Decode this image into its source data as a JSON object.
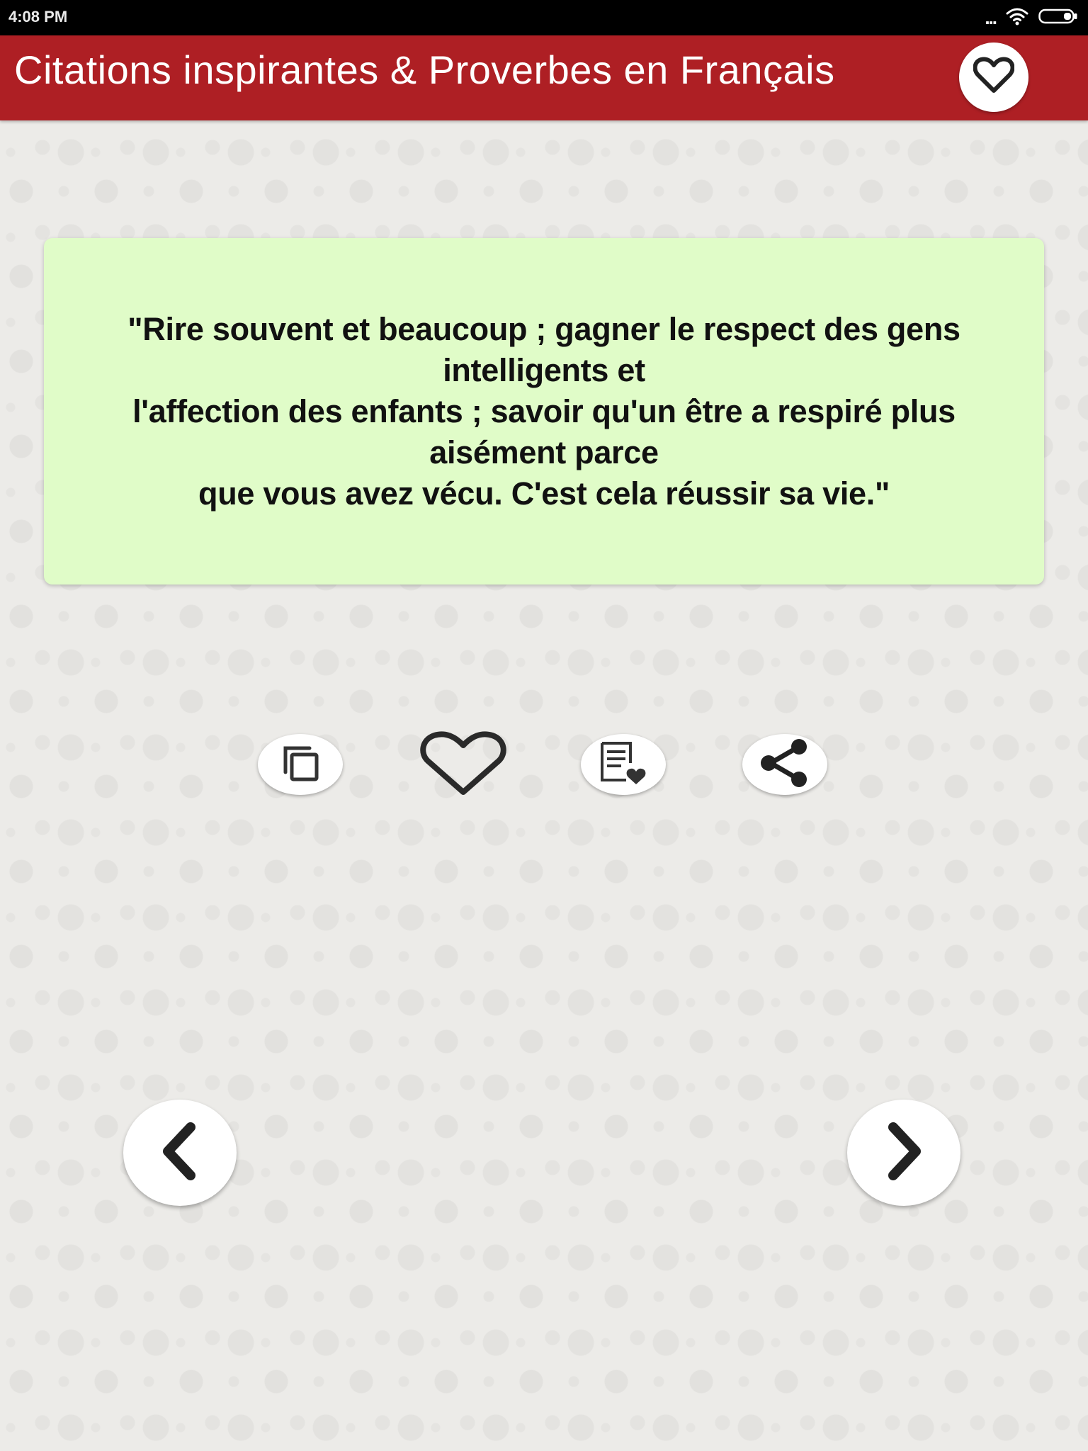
{
  "status_bar": {
    "time": "4:08 PM",
    "overflow_indicator": "...",
    "icons": [
      "wifi-icon",
      "battery-icon"
    ]
  },
  "app_bar": {
    "title": "Citations inspirantes & Proverbes en Français",
    "favorites_icon": "heart-outline-icon",
    "background_color": "#ae1f24"
  },
  "quote": {
    "text": "\"Rire souvent et beaucoup ; gagner le respect des gens\nintelligents et\nl'affection des enfants ; savoir qu'un être a respiré plus\naisément parce\nque vous avez vécu. C'est cela réussir sa vie.\"",
    "background_color": "#e0fcc8"
  },
  "actions": [
    {
      "name": "copy",
      "icon": "copy-icon"
    },
    {
      "name": "favorite",
      "icon": "heart-outline-icon"
    },
    {
      "name": "add-to-list",
      "icon": "list-heart-icon"
    },
    {
      "name": "share",
      "icon": "share-icon"
    }
  ],
  "navigation": {
    "previous_icon": "chevron-left-icon",
    "next_icon": "chevron-right-icon"
  }
}
